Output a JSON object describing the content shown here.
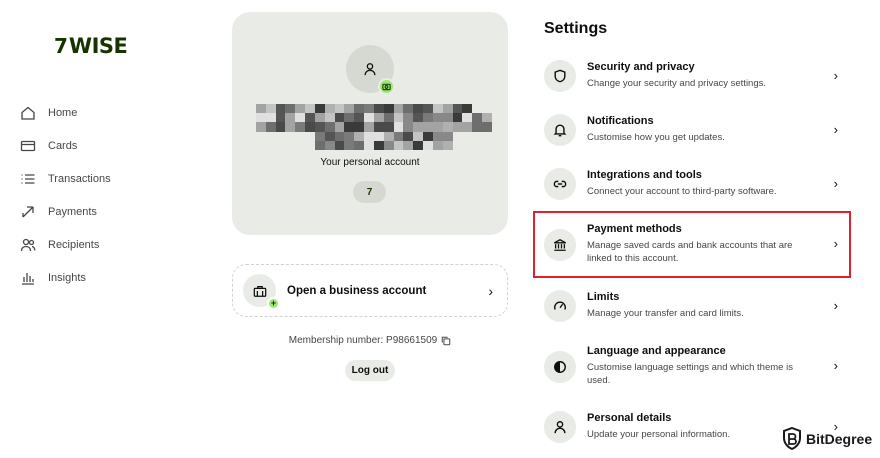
{
  "logo": {
    "mark": "7",
    "text": "WISE"
  },
  "sidebar": {
    "items": [
      {
        "label": "Home",
        "icon": "home-icon"
      },
      {
        "label": "Cards",
        "icon": "card-icon"
      },
      {
        "label": "Transactions",
        "icon": "list-icon"
      },
      {
        "label": "Payments",
        "icon": "transfer-arrows-icon"
      },
      {
        "label": "Recipients",
        "icon": "people-icon"
      },
      {
        "label": "Insights",
        "icon": "bar-chart-icon"
      }
    ]
  },
  "profile": {
    "account_label": "Your personal account",
    "pill_mark": "7"
  },
  "business": {
    "label": "Open a business account"
  },
  "membership": {
    "text": "Membership number: P98661509"
  },
  "logout_label": "Log out",
  "settings": {
    "title": "Settings",
    "items": [
      {
        "title": "Security and privacy",
        "desc": "Change your security and privacy settings.",
        "icon": "shield-icon"
      },
      {
        "title": "Notifications",
        "desc": "Customise how you get updates.",
        "icon": "bell-icon"
      },
      {
        "title": "Integrations and tools",
        "desc": "Connect your account to third-party software.",
        "icon": "link-icon"
      },
      {
        "title": "Payment methods",
        "desc": "Manage saved cards and bank accounts that are linked to this account.",
        "icon": "bank-icon"
      },
      {
        "title": "Limits",
        "desc": "Manage your transfer and card limits.",
        "icon": "speedometer-icon"
      },
      {
        "title": "Language and appearance",
        "desc": "Customise language settings and which theme is used.",
        "icon": "contrast-icon"
      },
      {
        "title": "Personal details",
        "desc": "Update your personal information.",
        "icon": "person-icon"
      }
    ]
  },
  "watermark": {
    "text": "BitDegree"
  },
  "colors": {
    "brand_green": "#9fe870",
    "brand_dark": "#163300",
    "card_bg": "#e8ebe6",
    "highlight": "#e0202a"
  }
}
